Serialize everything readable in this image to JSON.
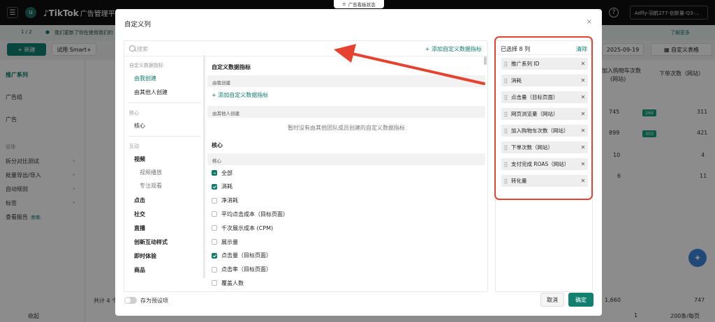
{
  "app": {
    "logo": "TikTok",
    "logo_sub": "广告管理平台",
    "avatar_letter": "u",
    "account": "Adfly-羽航277-创新量-Q3-...",
    "status_tab": "广告看板状态"
  },
  "background": {
    "pager": "1 / 2",
    "notice": "我们更新了你在使用我们的",
    "learn_more": "了解更多",
    "new_button": "+ 新建",
    "smart_button": "试用 Smart+",
    "date": "2025-09-19",
    "custom_table_button": "自定义表格",
    "sidebar": {
      "items": [
        "推广系列",
        "广告组",
        "广告"
      ],
      "manage_heading": "管理",
      "manage_items": [
        "拆分对比测试",
        "批量导出/导入",
        "自动规则",
        "标签",
        "查看报告"
      ],
      "new_badge": "新增",
      "collapse": "收起"
    },
    "table": {
      "col_cart": "加入购物车次数",
      "col_cart2": "(网站)",
      "col_orders": "下单次数（网站）",
      "rows": [
        {
          "a": "745",
          "badge": "264",
          "b": "311"
        },
        {
          "a": "899",
          "badge": "303",
          "b": "421"
        },
        {
          "a": "10",
          "badge": "",
          "b": "4"
        },
        {
          "a": "6",
          "badge": "",
          "b": "11"
        }
      ],
      "total_label": "共计 4 个",
      "total_a": "1,660",
      "total_b": "747",
      "page": "1",
      "per_page": "200条/每页"
    }
  },
  "modal": {
    "title": "自定义列",
    "close": "×",
    "search_placeholder": "搜索",
    "add_custom_link": "+ 添加自定义数据指标",
    "nav": {
      "g1": "自定义数据指标",
      "g1_items": [
        "由我创建",
        "由其他人创建"
      ],
      "g2": "核心",
      "g2_items": [
        "核心"
      ],
      "g3": "互动",
      "video": "视频",
      "video_subs": [
        "视频播放",
        "专注观看"
      ],
      "g3_rest": [
        "点击",
        "社交",
        "直播",
        "创新互动样式",
        "即时体验",
        "商品"
      ]
    },
    "middle": {
      "h1": "自定义数据指标",
      "sec_mine": "由我创建",
      "add_link": "+ 添加自定义数据指标",
      "sec_others": "由其他人创建",
      "empty": "暂时没有由其他团队成员创建的自定义数据指标",
      "h2": "核心",
      "sec_core": "核心",
      "checkboxes": [
        {
          "label": "全部",
          "state": "indeterminate"
        },
        {
          "label": "消耗",
          "state": "checked"
        },
        {
          "label": "净消耗",
          "state": "unchecked"
        },
        {
          "label": "平均点击成本（目标页面）",
          "state": "unchecked"
        },
        {
          "label": "千次展示成本 (CPM)",
          "state": "unchecked"
        },
        {
          "label": "展示量",
          "state": "unchecked"
        },
        {
          "label": "点击量（目标页面）",
          "state": "checked"
        },
        {
          "label": "点击率（目标页面）",
          "state": "unchecked"
        },
        {
          "label": "覆盖人数",
          "state": "unchecked"
        }
      ]
    },
    "selected": {
      "header": "已选择 8 列",
      "clear": "清除",
      "columns": [
        "推广系列 ID",
        "消耗",
        "点击量（目标页面）",
        "网页浏览量（网站）",
        "加入购物车次数（网站）",
        "下单次数（网站）",
        "支付完成 ROAS（网站）",
        "转化量"
      ]
    },
    "footer": {
      "save_preset": "存为预设项",
      "cancel": "取消",
      "confirm": "确定"
    }
  },
  "colors": {
    "brand": "#0e7b6b",
    "highlight": "#e5432f"
  }
}
